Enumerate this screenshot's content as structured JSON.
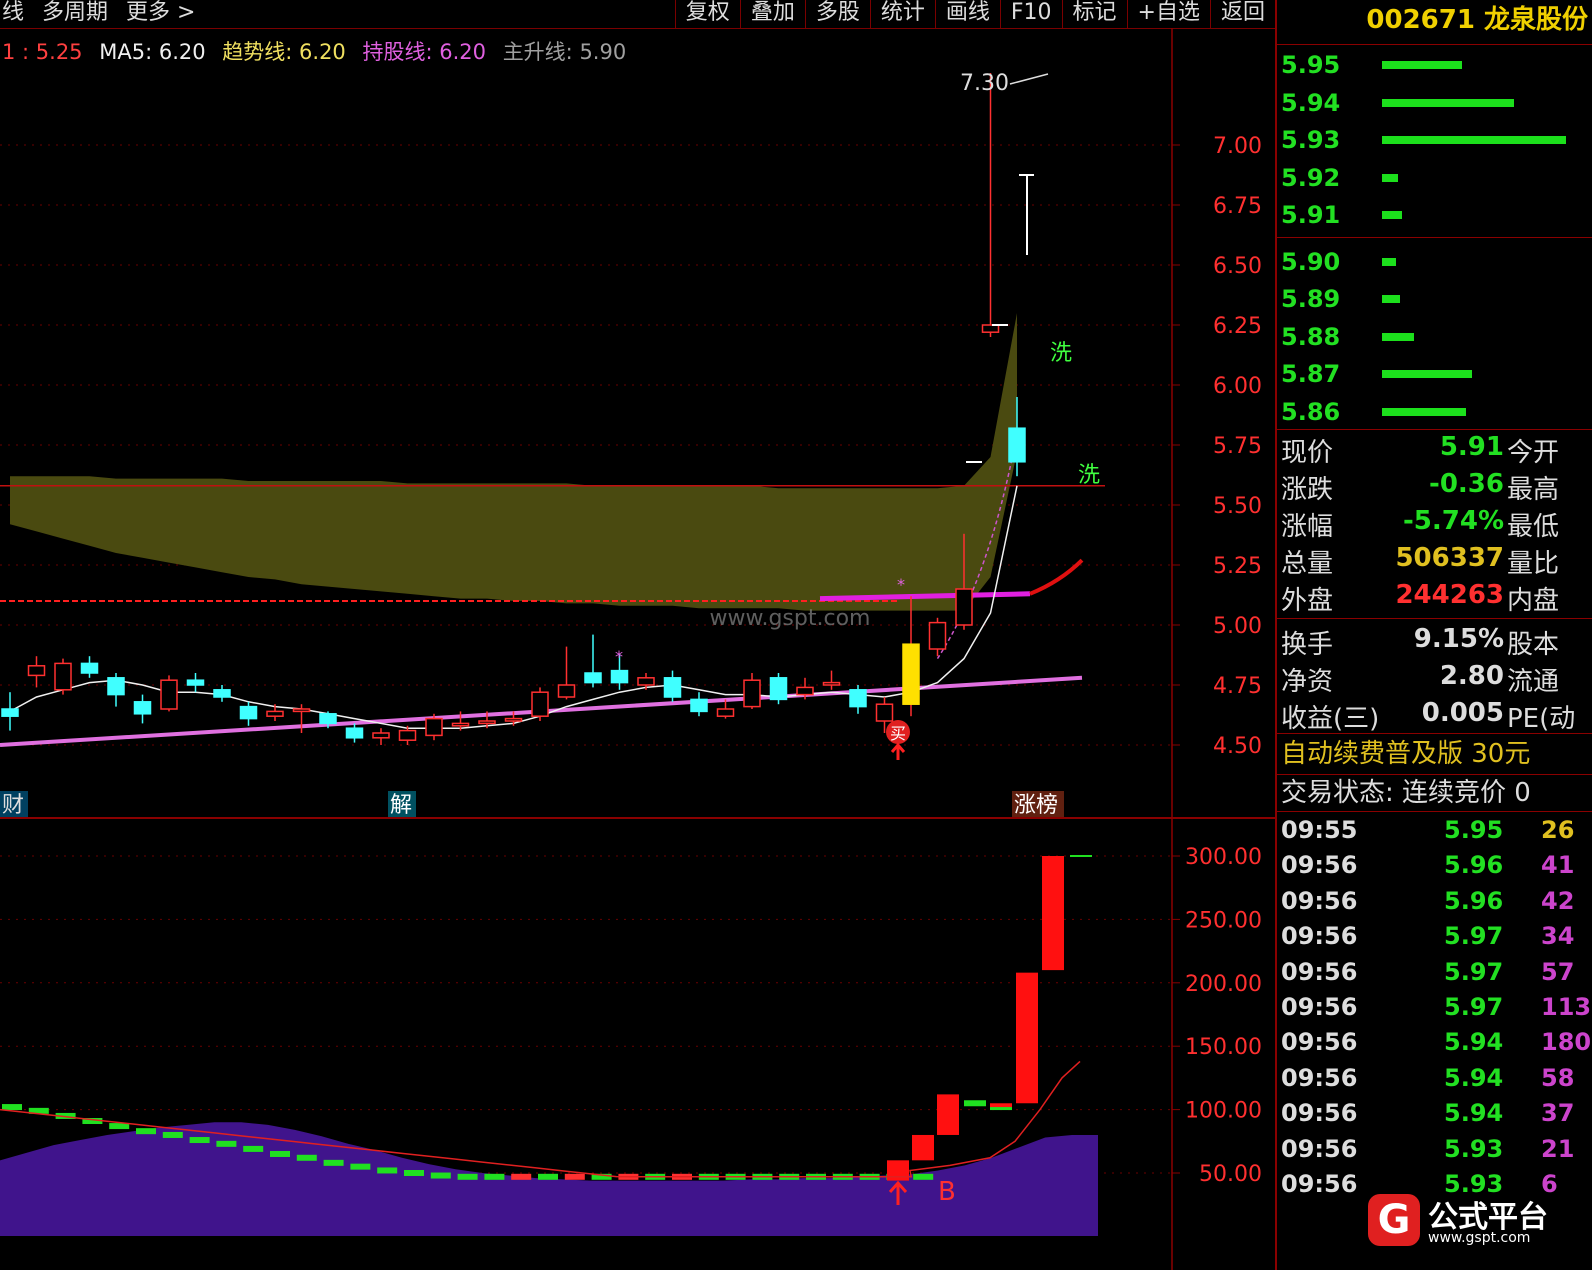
{
  "toolbar": {
    "left_items": [
      "线",
      "多周期",
      "更多 >"
    ],
    "right_items": [
      "复权",
      "叠加",
      "多股",
      "统计",
      "画线",
      "F10",
      "标记",
      "+自选",
      "返回"
    ]
  },
  "legend": {
    "first": "1 : 5.25",
    "ma5": "MA5: 6.20",
    "trend": "趋势线: 6.20",
    "hold": "持股线: 6.20",
    "main": "主升线: 5.90"
  },
  "stock": {
    "code": "002671",
    "name": "龙泉股份",
    "title": "002671 龙泉股份"
  },
  "order_book": {
    "asks": [
      {
        "price": "5.95",
        "size": 40
      },
      {
        "price": "5.94",
        "size": 66
      },
      {
        "price": "5.93",
        "size": 92
      },
      {
        "price": "5.92",
        "size": 8
      },
      {
        "price": "5.91",
        "size": 10
      }
    ],
    "bids": [
      {
        "price": "5.90",
        "size": 7
      },
      {
        "price": "5.89",
        "size": 9
      },
      {
        "price": "5.88",
        "size": 16
      },
      {
        "price": "5.87",
        "size": 45
      },
      {
        "price": "5.86",
        "size": 42
      }
    ]
  },
  "quote": {
    "group1": [
      {
        "label": "现价",
        "value": "5.91",
        "color": "#22e022",
        "label2": "今开"
      },
      {
        "label": "涨跌",
        "value": "-0.36",
        "color": "#22e022",
        "label2": "最高"
      },
      {
        "label": "涨幅",
        "value": "-5.74%",
        "color": "#22e022",
        "label2": "最低"
      },
      {
        "label": "总量",
        "value": "506337",
        "color": "#e0c020",
        "label2": "量比"
      },
      {
        "label": "外盘",
        "value": "244263",
        "color": "#ff3030",
        "label2": "内盘"
      }
    ],
    "group2": [
      {
        "label": "换手",
        "value": "9.15%",
        "color": "#dddddd",
        "label2": "股本"
      },
      {
        "label": "净资",
        "value": "2.80",
        "color": "#dddddd",
        "label2": "流通"
      },
      {
        "label": "收益(三)",
        "value": "0.005",
        "color": "#dddddd",
        "label2": "PE(动"
      }
    ]
  },
  "ad_text": "自动续费普及版  30元",
  "trade_status": "交易状态: 连续竞价  0",
  "ticks": [
    {
      "time": "09:55",
      "price": "5.95",
      "vol": "26",
      "color": "#e0c020"
    },
    {
      "time": "09:56",
      "price": "5.96",
      "vol": "41",
      "color": "#cc44cc"
    },
    {
      "time": "09:56",
      "price": "5.96",
      "vol": "42",
      "color": "#cc44cc"
    },
    {
      "time": "09:56",
      "price": "5.97",
      "vol": "34",
      "color": "#cc44cc"
    },
    {
      "time": "09:56",
      "price": "5.97",
      "vol": "57",
      "color": "#cc44cc"
    },
    {
      "time": "09:56",
      "price": "5.97",
      "vol": "113",
      "color": "#cc44cc"
    },
    {
      "time": "09:56",
      "price": "5.94",
      "vol": "180",
      "color": "#cc44cc"
    },
    {
      "time": "09:56",
      "price": "5.94",
      "vol": "58",
      "color": "#cc44cc"
    },
    {
      "time": "09:56",
      "price": "5.94",
      "vol": "37",
      "color": "#cc44cc"
    },
    {
      "time": "09:56",
      "price": "5.93",
      "vol": "21",
      "color": "#cc44cc"
    },
    {
      "time": "09:56",
      "price": "5.93",
      "vol": "6",
      "color": "#cc44cc"
    }
  ],
  "logo": {
    "text": "公式平台",
    "url": "www.gspt.com",
    "mark": "G"
  },
  "chart_data": [
    {
      "type": "candlestick",
      "name": "price",
      "y_ticks": [
        4.5,
        4.75,
        5.0,
        5.25,
        5.5,
        5.75,
        6.0,
        6.25,
        6.5,
        6.75,
        7.0
      ],
      "ylim": [
        4.25,
        7.35
      ],
      "grid": true,
      "watermark": "www.gspt.com",
      "annotations": {
        "high": "7.30",
        "wash1": "洗",
        "wash2": "洗",
        "buy": "买",
        "tag_cai": "财",
        "tag_jie": "解",
        "tag_zhangbang": "涨榜"
      },
      "candles": [
        {
          "o": 4.65,
          "c": 4.62,
          "h": 4.72,
          "l": 4.56
        },
        {
          "o": 4.79,
          "c": 4.83,
          "h": 4.87,
          "l": 4.74
        },
        {
          "o": 4.73,
          "c": 4.84,
          "h": 4.86,
          "l": 4.71
        },
        {
          "o": 4.84,
          "c": 4.8,
          "h": 4.87,
          "l": 4.78
        },
        {
          "o": 4.78,
          "c": 4.71,
          "h": 4.8,
          "l": 4.66
        },
        {
          "o": 4.68,
          "c": 4.63,
          "h": 4.71,
          "l": 4.59
        },
        {
          "o": 4.65,
          "c": 4.77,
          "h": 4.79,
          "l": 4.64
        },
        {
          "o": 4.77,
          "c": 4.75,
          "h": 4.8,
          "l": 4.72
        },
        {
          "o": 4.73,
          "c": 4.7,
          "h": 4.75,
          "l": 4.68
        },
        {
          "o": 4.66,
          "c": 4.61,
          "h": 4.68,
          "l": 4.58
        },
        {
          "o": 4.62,
          "c": 4.64,
          "h": 4.67,
          "l": 4.6
        },
        {
          "o": 4.64,
          "c": 4.65,
          "h": 4.67,
          "l": 4.55
        },
        {
          "o": 4.63,
          "c": 4.59,
          "h": 4.64,
          "l": 4.57
        },
        {
          "o": 4.57,
          "c": 4.53,
          "h": 4.59,
          "l": 4.51
        },
        {
          "o": 4.53,
          "c": 4.55,
          "h": 4.57,
          "l": 4.5
        },
        {
          "o": 4.52,
          "c": 4.56,
          "h": 4.58,
          "l": 4.5
        },
        {
          "o": 4.54,
          "c": 4.61,
          "h": 4.63,
          "l": 4.52
        },
        {
          "o": 4.58,
          "c": 4.59,
          "h": 4.64,
          "l": 4.56
        },
        {
          "o": 4.59,
          "c": 4.6,
          "h": 4.64,
          "l": 4.57
        },
        {
          "o": 4.6,
          "c": 4.61,
          "h": 4.64,
          "l": 4.58
        },
        {
          "o": 4.62,
          "c": 4.72,
          "h": 4.74,
          "l": 4.6
        },
        {
          "o": 4.7,
          "c": 4.75,
          "h": 4.91,
          "l": 4.69
        },
        {
          "o": 4.8,
          "c": 4.76,
          "h": 4.96,
          "l": 4.74
        },
        {
          "o": 4.81,
          "c": 4.76,
          "h": 4.88,
          "l": 4.73
        },
        {
          "o": 4.75,
          "c": 4.78,
          "h": 4.8,
          "l": 4.73
        },
        {
          "o": 4.78,
          "c": 4.7,
          "h": 4.81,
          "l": 4.68
        },
        {
          "o": 4.69,
          "c": 4.64,
          "h": 4.72,
          "l": 4.62
        },
        {
          "o": 4.62,
          "c": 4.65,
          "h": 4.69,
          "l": 4.61
        },
        {
          "o": 4.66,
          "c": 4.77,
          "h": 4.8,
          "l": 4.65
        },
        {
          "o": 4.78,
          "c": 4.69,
          "h": 4.8,
          "l": 4.67
        },
        {
          "o": 4.71,
          "c": 4.74,
          "h": 4.78,
          "l": 4.69
        },
        {
          "o": 4.75,
          "c": 4.76,
          "h": 4.81,
          "l": 4.73
        },
        {
          "o": 4.73,
          "c": 4.66,
          "h": 4.75,
          "l": 4.63
        },
        {
          "o": 4.6,
          "c": 4.67,
          "h": 4.7,
          "l": 4.55
        },
        {
          "o": 4.67,
          "c": 4.92,
          "h": 5.12,
          "l": 4.62
        },
        {
          "o": 4.9,
          "c": 5.01,
          "h": 5.03,
          "l": 4.87
        },
        {
          "o": 5.0,
          "c": 5.15,
          "h": 5.38,
          "l": 4.98
        },
        {
          "o": 6.22,
          "c": 6.25,
          "h": 7.3,
          "l": 6.2
        },
        {
          "o": 5.82,
          "c": 5.68,
          "h": 5.95,
          "l": 5.62
        }
      ],
      "lines": {
        "ma5": [
          4.64,
          4.7,
          4.73,
          4.76,
          4.77,
          4.75,
          4.72,
          4.72,
          4.71,
          4.68,
          4.66,
          4.65,
          4.63,
          4.61,
          4.59,
          4.57,
          4.57,
          4.57,
          4.58,
          4.59,
          4.62,
          4.66,
          4.69,
          4.72,
          4.74,
          4.75,
          4.73,
          4.71,
          4.71,
          4.7,
          4.71,
          4.72,
          4.71,
          4.7,
          4.72,
          4.76,
          4.86,
          5.05,
          5.58
        ],
        "trend_band_upper": [
          5.62,
          5.62,
          5.62,
          5.62,
          5.61,
          5.61,
          5.61,
          5.61,
          5.61,
          5.6,
          5.6,
          5.6,
          5.6,
          5.6,
          5.6,
          5.59,
          5.59,
          5.59,
          5.59,
          5.59,
          5.59,
          5.59,
          5.58,
          5.58,
          5.58,
          5.58,
          5.58,
          5.58,
          5.58,
          5.57,
          5.57,
          5.57,
          5.57,
          5.57,
          5.57,
          5.57,
          5.58,
          5.7,
          6.3
        ],
        "trend_band_lower": [
          5.42,
          5.39,
          5.36,
          5.33,
          5.3,
          5.28,
          5.26,
          5.24,
          5.22,
          5.2,
          5.19,
          5.17,
          5.16,
          5.15,
          5.14,
          5.13,
          5.12,
          5.11,
          5.11,
          5.1,
          5.1,
          5.09,
          5.09,
          5.08,
          5.08,
          5.08,
          5.07,
          5.07,
          5.07,
          5.07,
          5.06,
          5.06,
          5.06,
          5.06,
          5.06,
          5.06,
          5.06,
          5.2,
          5.72
        ]
      }
    },
    {
      "type": "bar",
      "name": "volume_indicator",
      "y_ticks": [
        50.0,
        100.0,
        150.0,
        200.0,
        250.0,
        300.0
      ],
      "ylim": [
        0,
        320
      ],
      "grid": true,
      "annotations": {
        "buy_mark": "B"
      },
      "area": [
        60,
        66,
        72,
        76,
        80,
        83,
        86,
        88,
        90,
        90,
        88,
        84,
        79,
        73,
        68,
        62,
        57,
        53,
        50,
        48,
        46,
        45,
        44,
        44,
        44,
        44,
        44,
        44,
        45,
        45,
        46,
        46,
        47,
        48,
        49,
        52,
        56,
        62,
        70,
        78,
        80
      ],
      "signal": [
        102,
        99,
        95,
        91,
        87,
        83,
        80,
        76,
        73,
        69,
        65,
        62,
        58,
        55,
        52,
        50,
        48,
        47,
        47,
        47,
        47,
        47,
        47,
        47,
        47,
        47,
        47,
        47,
        47,
        47,
        47,
        47,
        47,
        47,
        47,
        105,
        105,
        105,
        105,
        105,
        105
      ],
      "bars": [
        {
          "low": 44,
          "high": 60
        },
        {
          "low": 60,
          "high": 80
        },
        {
          "low": 80,
          "high": 112
        },
        {
          "low": 102,
          "high": 105
        },
        {
          "low": 105,
          "high": 208
        },
        {
          "low": 210,
          "high": 300
        }
      ],
      "signal_line": [
        48,
        52,
        56,
        60,
        68,
        85,
        110,
        138
      ]
    }
  ]
}
